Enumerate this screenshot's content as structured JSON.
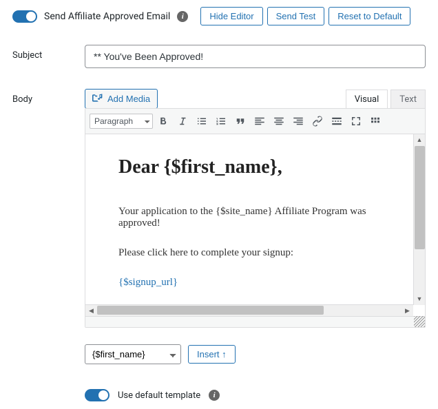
{
  "header": {
    "toggle_label": "Send Affiliate Approved Email",
    "info_glyph": "i",
    "buttons": {
      "hide_editor": "Hide Editor",
      "send_test": "Send Test",
      "reset_default": "Reset to Default"
    }
  },
  "labels": {
    "subject": "Subject",
    "body": "Body"
  },
  "subject_value": "** You've Been Approved!",
  "editor": {
    "add_media": "Add Media",
    "tabs": {
      "visual": "Visual",
      "text": "Text"
    },
    "format_option": "Paragraph",
    "content": {
      "heading": "Dear {$first_name},",
      "para1": "Your application to the {$site_name} Affiliate Program was approved!",
      "para2": "Please click here to complete your signup:",
      "signup": "{$signup_url}"
    }
  },
  "insert": {
    "selected": "{$first_name}",
    "button": "Insert ↑"
  },
  "template": {
    "label": "Use default template",
    "info_glyph": "i"
  }
}
